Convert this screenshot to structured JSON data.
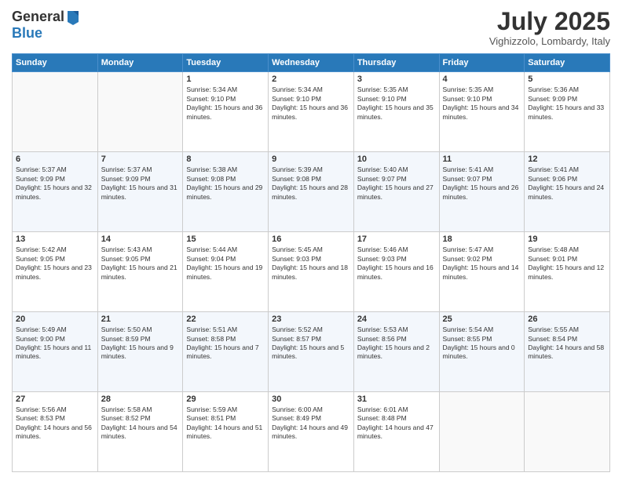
{
  "header": {
    "logo_line1": "General",
    "logo_line2": "Blue",
    "month": "July 2025",
    "location": "Vighizzolo, Lombardy, Italy"
  },
  "weekdays": [
    "Sunday",
    "Monday",
    "Tuesday",
    "Wednesday",
    "Thursday",
    "Friday",
    "Saturday"
  ],
  "weeks": [
    [
      {
        "day": "",
        "info": ""
      },
      {
        "day": "",
        "info": ""
      },
      {
        "day": "1",
        "info": "Sunrise: 5:34 AM\nSunset: 9:10 PM\nDaylight: 15 hours and 36 minutes."
      },
      {
        "day": "2",
        "info": "Sunrise: 5:34 AM\nSunset: 9:10 PM\nDaylight: 15 hours and 36 minutes."
      },
      {
        "day": "3",
        "info": "Sunrise: 5:35 AM\nSunset: 9:10 PM\nDaylight: 15 hours and 35 minutes."
      },
      {
        "day": "4",
        "info": "Sunrise: 5:35 AM\nSunset: 9:10 PM\nDaylight: 15 hours and 34 minutes."
      },
      {
        "day": "5",
        "info": "Sunrise: 5:36 AM\nSunset: 9:09 PM\nDaylight: 15 hours and 33 minutes."
      }
    ],
    [
      {
        "day": "6",
        "info": "Sunrise: 5:37 AM\nSunset: 9:09 PM\nDaylight: 15 hours and 32 minutes."
      },
      {
        "day": "7",
        "info": "Sunrise: 5:37 AM\nSunset: 9:09 PM\nDaylight: 15 hours and 31 minutes."
      },
      {
        "day": "8",
        "info": "Sunrise: 5:38 AM\nSunset: 9:08 PM\nDaylight: 15 hours and 29 minutes."
      },
      {
        "day": "9",
        "info": "Sunrise: 5:39 AM\nSunset: 9:08 PM\nDaylight: 15 hours and 28 minutes."
      },
      {
        "day": "10",
        "info": "Sunrise: 5:40 AM\nSunset: 9:07 PM\nDaylight: 15 hours and 27 minutes."
      },
      {
        "day": "11",
        "info": "Sunrise: 5:41 AM\nSunset: 9:07 PM\nDaylight: 15 hours and 26 minutes."
      },
      {
        "day": "12",
        "info": "Sunrise: 5:41 AM\nSunset: 9:06 PM\nDaylight: 15 hours and 24 minutes."
      }
    ],
    [
      {
        "day": "13",
        "info": "Sunrise: 5:42 AM\nSunset: 9:05 PM\nDaylight: 15 hours and 23 minutes."
      },
      {
        "day": "14",
        "info": "Sunrise: 5:43 AM\nSunset: 9:05 PM\nDaylight: 15 hours and 21 minutes."
      },
      {
        "day": "15",
        "info": "Sunrise: 5:44 AM\nSunset: 9:04 PM\nDaylight: 15 hours and 19 minutes."
      },
      {
        "day": "16",
        "info": "Sunrise: 5:45 AM\nSunset: 9:03 PM\nDaylight: 15 hours and 18 minutes."
      },
      {
        "day": "17",
        "info": "Sunrise: 5:46 AM\nSunset: 9:03 PM\nDaylight: 15 hours and 16 minutes."
      },
      {
        "day": "18",
        "info": "Sunrise: 5:47 AM\nSunset: 9:02 PM\nDaylight: 15 hours and 14 minutes."
      },
      {
        "day": "19",
        "info": "Sunrise: 5:48 AM\nSunset: 9:01 PM\nDaylight: 15 hours and 12 minutes."
      }
    ],
    [
      {
        "day": "20",
        "info": "Sunrise: 5:49 AM\nSunset: 9:00 PM\nDaylight: 15 hours and 11 minutes."
      },
      {
        "day": "21",
        "info": "Sunrise: 5:50 AM\nSunset: 8:59 PM\nDaylight: 15 hours and 9 minutes."
      },
      {
        "day": "22",
        "info": "Sunrise: 5:51 AM\nSunset: 8:58 PM\nDaylight: 15 hours and 7 minutes."
      },
      {
        "day": "23",
        "info": "Sunrise: 5:52 AM\nSunset: 8:57 PM\nDaylight: 15 hours and 5 minutes."
      },
      {
        "day": "24",
        "info": "Sunrise: 5:53 AM\nSunset: 8:56 PM\nDaylight: 15 hours and 2 minutes."
      },
      {
        "day": "25",
        "info": "Sunrise: 5:54 AM\nSunset: 8:55 PM\nDaylight: 15 hours and 0 minutes."
      },
      {
        "day": "26",
        "info": "Sunrise: 5:55 AM\nSunset: 8:54 PM\nDaylight: 14 hours and 58 minutes."
      }
    ],
    [
      {
        "day": "27",
        "info": "Sunrise: 5:56 AM\nSunset: 8:53 PM\nDaylight: 14 hours and 56 minutes."
      },
      {
        "day": "28",
        "info": "Sunrise: 5:58 AM\nSunset: 8:52 PM\nDaylight: 14 hours and 54 minutes."
      },
      {
        "day": "29",
        "info": "Sunrise: 5:59 AM\nSunset: 8:51 PM\nDaylight: 14 hours and 51 minutes."
      },
      {
        "day": "30",
        "info": "Sunrise: 6:00 AM\nSunset: 8:49 PM\nDaylight: 14 hours and 49 minutes."
      },
      {
        "day": "31",
        "info": "Sunrise: 6:01 AM\nSunset: 8:48 PM\nDaylight: 14 hours and 47 minutes."
      },
      {
        "day": "",
        "info": ""
      },
      {
        "day": "",
        "info": ""
      }
    ]
  ]
}
